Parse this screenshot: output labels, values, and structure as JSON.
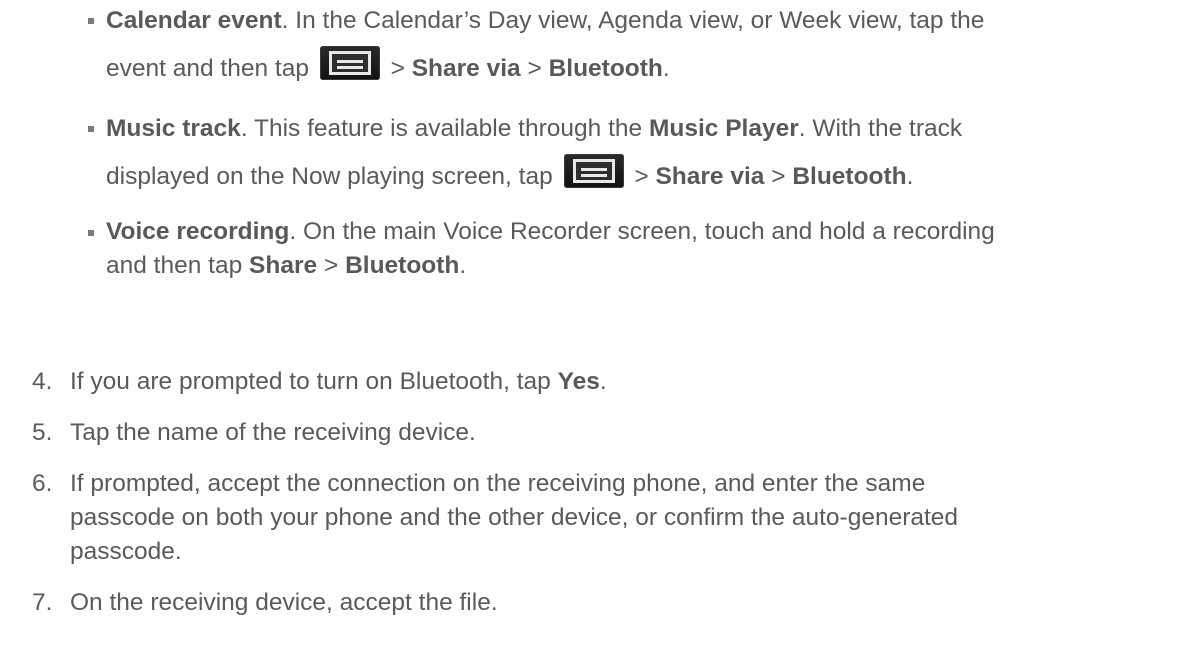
{
  "bullets": [
    {
      "title": "Calendar event",
      "line1": ". In the Calendar’s Day view, Agenda view, or Week view, tap the",
      "line2_pre": "event and then tap ",
      "sep1": " > ",
      "share_via": "Share via",
      "sep2": " > ",
      "bluetooth": "Bluetooth",
      "end": "."
    },
    {
      "title": "Music track",
      "line1_a": ". This feature is available through the ",
      "music_player": "Music Player",
      "line1_b": ". With the track",
      "line2_pre": "displayed on the Now playing screen, tap ",
      "sep1": " > ",
      "share_via": "Share via",
      "sep2": " > ",
      "bluetooth": "Bluetooth",
      "end": "."
    },
    {
      "title": "Voice recording",
      "line1": ". On the main Voice Recorder screen, touch and hold a recording",
      "line2_pre": "and then tap ",
      "share": "Share",
      "sep": " > ",
      "bluetooth": "Bluetooth",
      "end": "."
    }
  ],
  "steps": [
    {
      "num": "4.",
      "pre": "If you are prompted to turn on Bluetooth, tap ",
      "bold": "Yes",
      "post": "."
    },
    {
      "num": "5.",
      "text": "Tap the name of the receiving device."
    },
    {
      "num": "6.",
      "line1": "If prompted, accept the connection on the receiving phone, and enter the same",
      "line2": "passcode on both your phone and the other device, or confirm the auto-generated",
      "line3": "passcode."
    },
    {
      "num": "7.",
      "text": "On the receiving device, accept the file."
    }
  ],
  "icons": {
    "menu": "menu-key-icon"
  }
}
